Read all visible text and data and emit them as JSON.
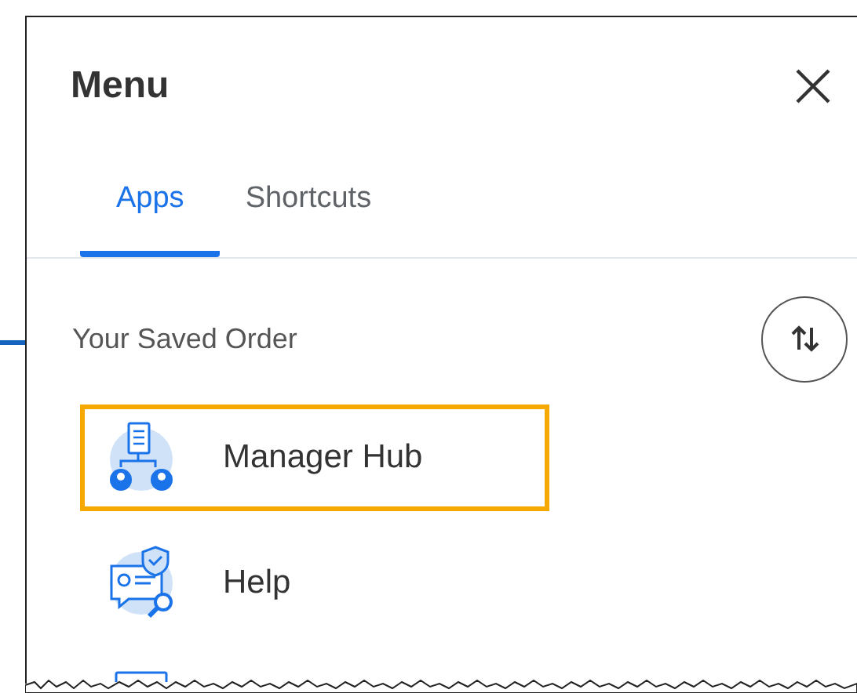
{
  "panel": {
    "title": "Menu"
  },
  "tabs": [
    {
      "label": "Apps",
      "selected": true
    },
    {
      "label": "Shortcuts",
      "selected": false
    }
  ],
  "section": {
    "heading": "Your Saved Order"
  },
  "apps": [
    {
      "kind": "hub",
      "label": "Manager Hub",
      "highlighted": true
    },
    {
      "kind": "help",
      "label": "Help",
      "highlighted": false
    },
    {
      "kind": "partial",
      "highlighted": false
    }
  ]
}
